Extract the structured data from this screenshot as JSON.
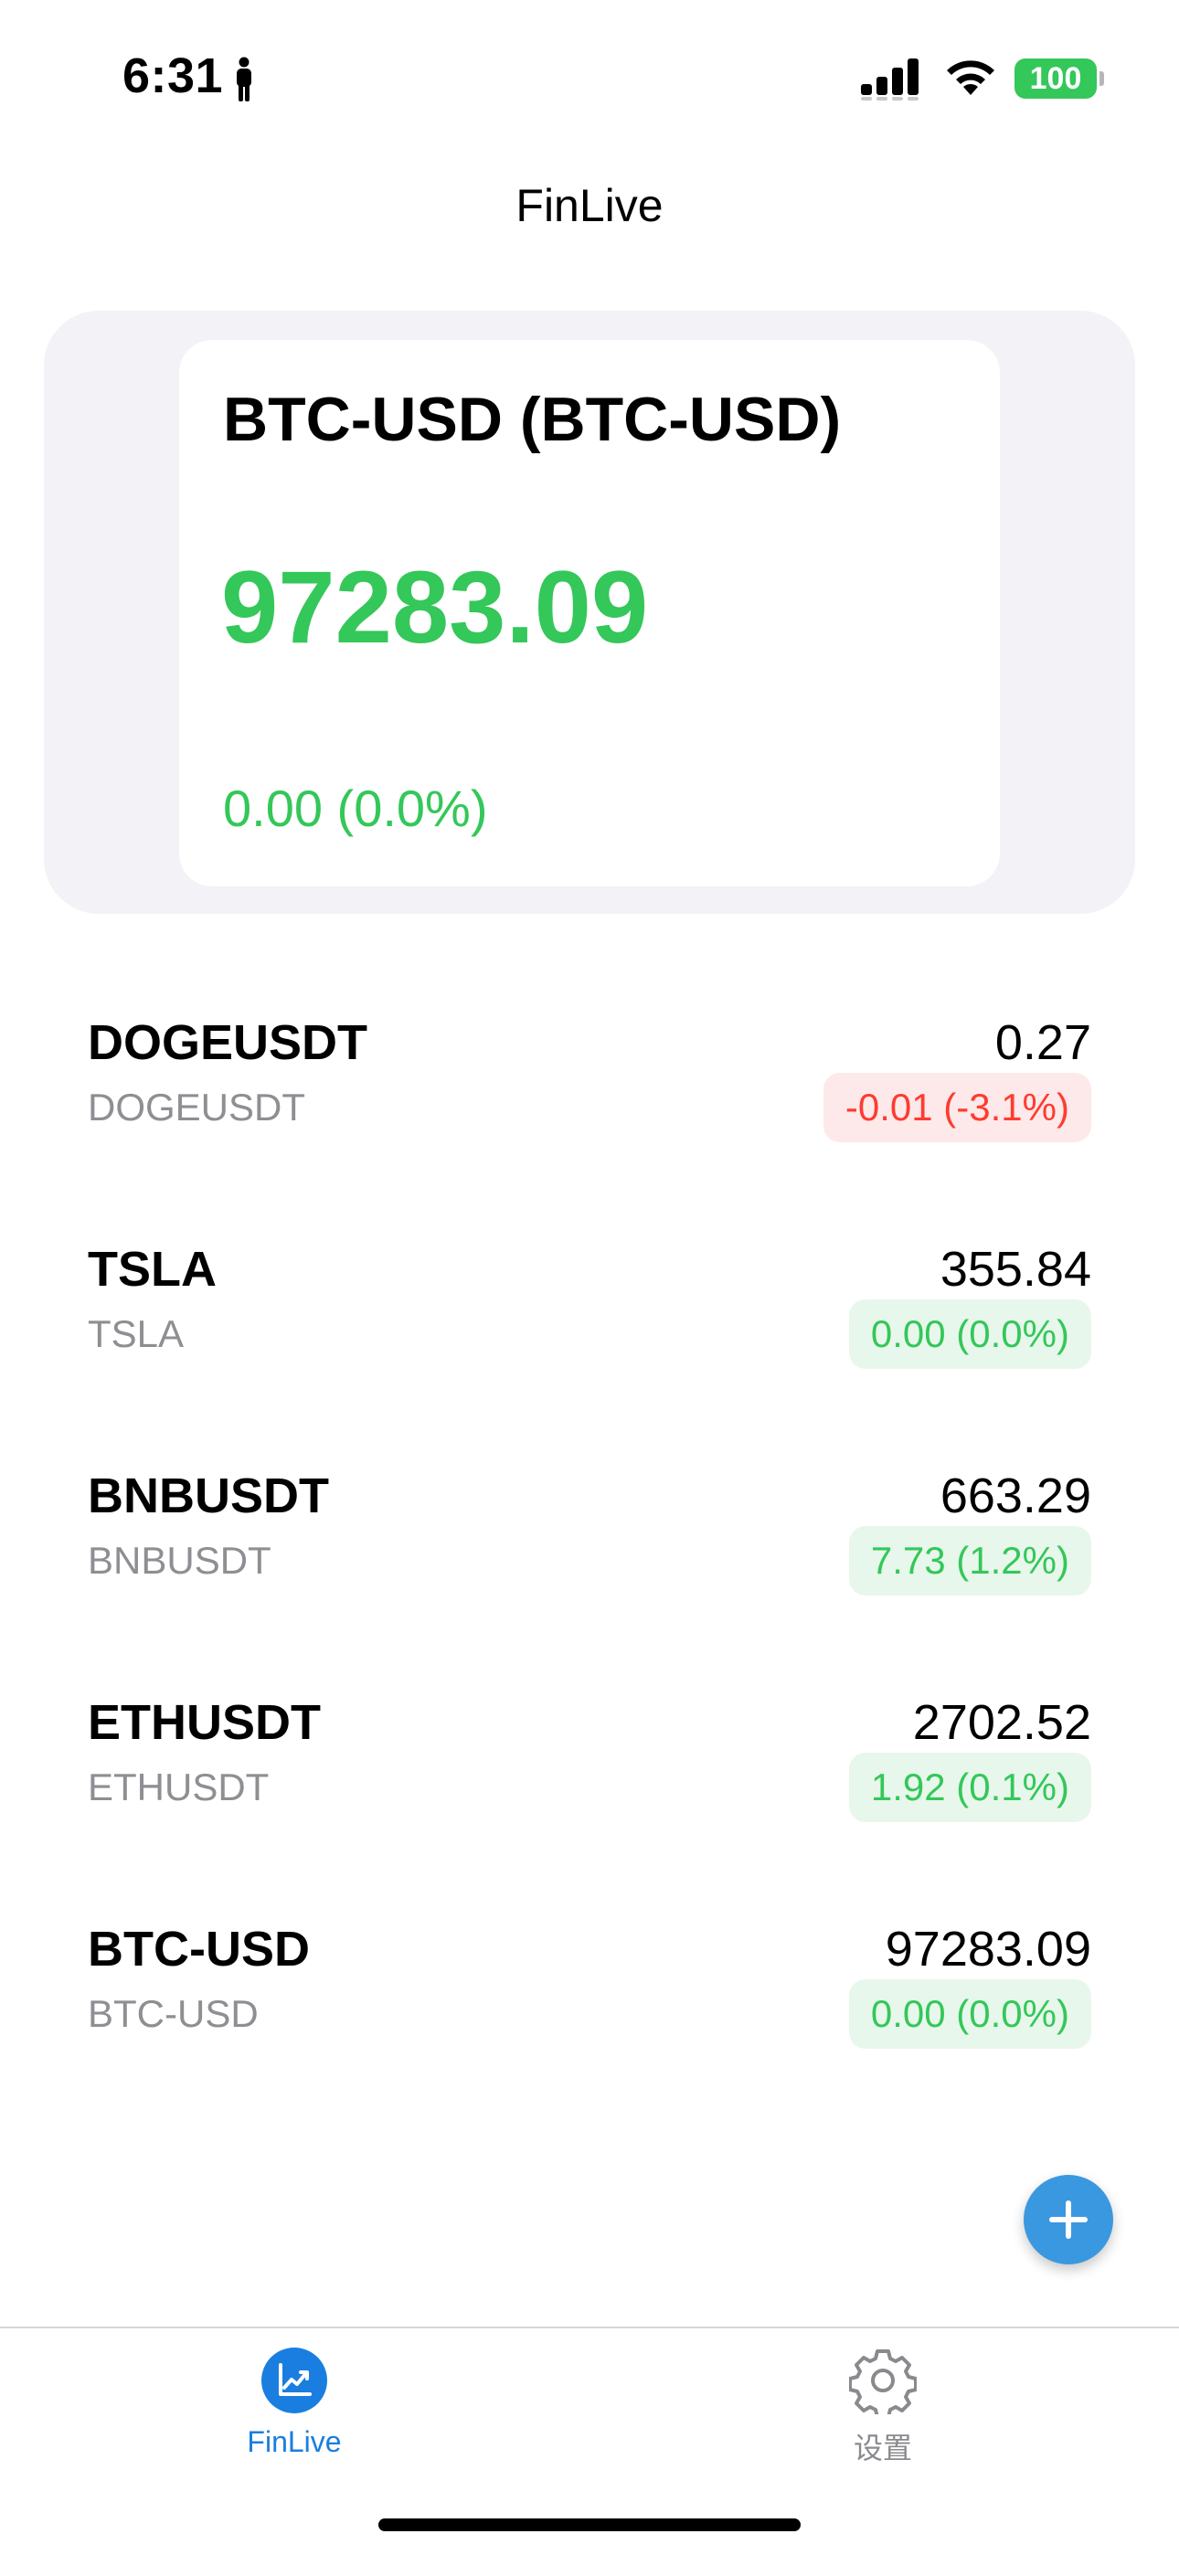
{
  "status_bar": {
    "time": "6:31",
    "battery": "100",
    "icons": [
      "person-icon",
      "signal-icon",
      "wifi-icon",
      "battery-icon"
    ]
  },
  "header": {
    "title": "FinLive"
  },
  "featured": {
    "title": "BTC-USD (BTC-USD)",
    "price": "97283.09",
    "change": "0.00 (0.0%)"
  },
  "watchlist": [
    {
      "symbol": "DOGEUSDT",
      "name": "DOGEUSDT",
      "price": "0.27",
      "change": "-0.01 (-3.1%)",
      "direction": "down"
    },
    {
      "symbol": "TSLA",
      "name": "TSLA",
      "price": "355.84",
      "change": "0.00 (0.0%)",
      "direction": "up"
    },
    {
      "symbol": "BNBUSDT",
      "name": "BNBUSDT",
      "price": "663.29",
      "change": "7.73 (1.2%)",
      "direction": "up"
    },
    {
      "symbol": "ETHUSDT",
      "name": "ETHUSDT",
      "price": "2702.52",
      "change": "1.92 (0.1%)",
      "direction": "up"
    },
    {
      "symbol": "BTC-USD",
      "name": "BTC-USD",
      "price": "97283.09",
      "change": "0.00 (0.0%)",
      "direction": "up"
    }
  ],
  "fab": {
    "icon": "plus-icon"
  },
  "tabs": [
    {
      "label": "FinLive",
      "icon": "chart-icon",
      "active": true
    },
    {
      "label": "设置",
      "icon": "gear-icon",
      "active": false
    }
  ],
  "colors": {
    "positive": "#34c759",
    "negative": "#ff3b30",
    "accent": "#1a7ee0",
    "fab": "#3a98e0"
  }
}
